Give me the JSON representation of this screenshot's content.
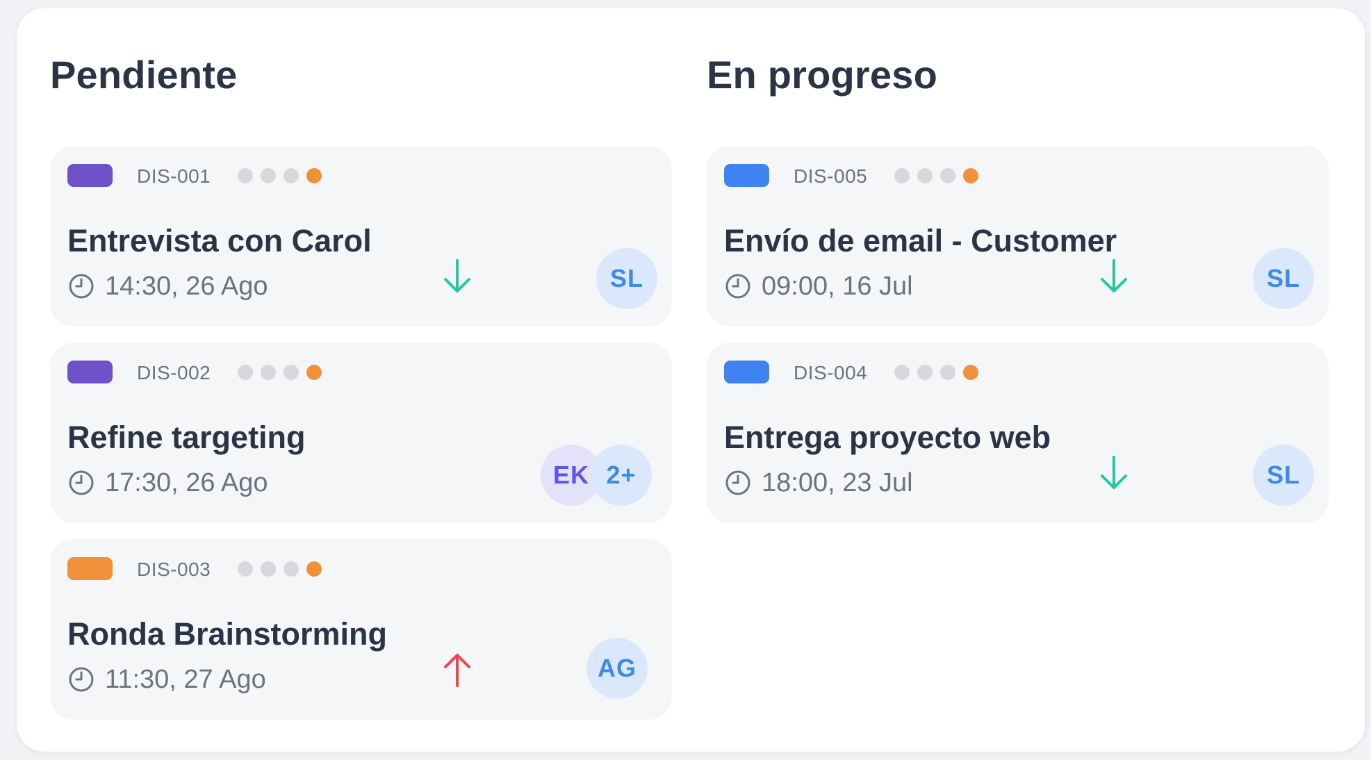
{
  "columns": [
    {
      "title": "Pendiente",
      "cards": [
        {
          "id": "DIS-001",
          "tag_color": "#6f52c9",
          "title": "Entrevista con Carol",
          "time": "14:30, 26 Ago",
          "priority": "down",
          "avatars": [
            {
              "initials": "SL",
              "style": "blue"
            }
          ]
        },
        {
          "id": "DIS-002",
          "tag_color": "#6f52c9",
          "title": "Refine targeting",
          "time": "17:30, 26 Ago",
          "priority": "none",
          "avatars": [
            {
              "initials": "EK",
              "style": "purple"
            },
            {
              "initials": "2+",
              "style": "blue"
            }
          ]
        },
        {
          "id": "DIS-003",
          "tag_color": "#f0913a",
          "title": "Ronda Brainstorming",
          "time": "11:30, 27 Ago",
          "priority": "up",
          "avatars": [
            {
              "initials": "AG",
              "style": "blue"
            }
          ]
        }
      ]
    },
    {
      "title": "En progreso",
      "cards": [
        {
          "id": "DIS-005",
          "tag_color": "#3f82f2",
          "title": "Envío de email - Customer",
          "time": "09:00, 16 Jul",
          "priority": "down",
          "avatars": [
            {
              "initials": "SL",
              "style": "blue"
            }
          ]
        },
        {
          "id": "DIS-004",
          "tag_color": "#3f82f2",
          "title": "Entrega proyecto web",
          "time": "18:00, 23 Jul",
          "priority": "down",
          "avatars": [
            {
              "initials": "SL",
              "style": "blue"
            }
          ]
        }
      ]
    }
  ],
  "progress_dots": {
    "total": 4,
    "active_index": 3
  },
  "colors": {
    "priority_down": "#23c9a0",
    "priority_up": "#f0454a",
    "dot_inactive": "#d7d8dc",
    "dot_active": "#f0913a"
  },
  "icons": {
    "clock": "clock-icon",
    "priority_down": "arrow-down-icon",
    "priority_up": "arrow-up-icon"
  }
}
